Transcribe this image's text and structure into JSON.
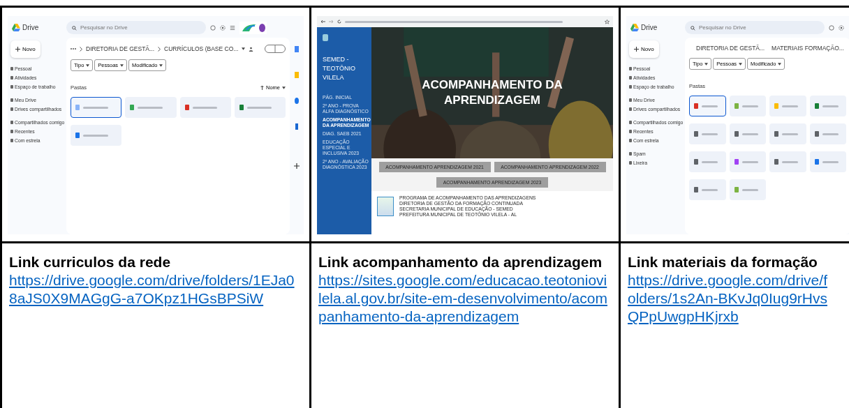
{
  "cells": [
    {
      "kind": "drive",
      "title": "Link curriculos da rede",
      "link": "https://drive.google.com/drive/folders/1EJa08aJS0X9MAGgG-a7OKpz1HGsBPSiW",
      "screen": {
        "app": "Drive",
        "search": {
          "placeholder": "Pesquisar no Drive"
        },
        "new_button": "Novo",
        "nav": [
          "Pessoal",
          "Atividades",
          "Espaço de trabalho",
          "Meu Drive",
          "Drives compartilhados",
          "Compartilhados comigo",
          "Recentes",
          "Com estrela"
        ],
        "breadcrumb": [
          "DIRETORIA DE GESTÃ...",
          "CURRÍCULOS (BASE CO..."
        ],
        "filters": [
          "Tipo",
          "Pessoas",
          "Modificado"
        ],
        "section": "Pastas",
        "sort": "Nome",
        "folders": [
          {
            "color": "#8ab4f8",
            "selected": true
          },
          {
            "color": "#34a853",
            "selected": false
          },
          {
            "color": "#d93025",
            "selected": false
          },
          {
            "color": "#188038",
            "selected": false
          },
          {
            "color": "#1a73e8",
            "selected": false
          }
        ],
        "rail": true
      }
    },
    {
      "kind": "site",
      "title": "Link acompanhamento da aprendizagem",
      "link": "https://sites.google.com/educacao.teotoniovilela.al.gov.br/site-em-desenvolvimento/acompanhamento-da-aprendizagem",
      "screen": {
        "site_name": "SEMED - TEOTÔNIO VILELA",
        "nav": [
          {
            "label": "PÁG. INICIAL",
            "selected": false
          },
          {
            "label": "2º ANO - PROVA ALFA DIAGNÓSTICO",
            "selected": false
          },
          {
            "label": "ACOMPANHAMENTO DA APRENDIZAGEM",
            "selected": true
          },
          {
            "label": "DIAG. SAEB 2021",
            "selected": false
          },
          {
            "label": "EDUCAÇÃO ESPECIAL E INCLUSIVA 2023",
            "selected": false
          },
          {
            "label": "2º ANO - AVALIAÇÃO DIAGNÓSTICA 2023",
            "selected": false
          }
        ],
        "hero_title": "ACOMPANHAMENTO DA APRENDIZAGEM",
        "buttons": [
          "ACOMPANHAMENTO APRENDIZAGEM 2021",
          "ACOMPANHAMENTO APRENDIZAGEM 2022",
          "ACOMPANHAMENTO APRENDIZAGEM 2023"
        ],
        "footer": [
          "PROGRAMA DE ACOMPANHAMENTO DAS APRENDIZAGENS",
          "DIRETORIA DE GESTÃO DA FORMAÇÃO CONTINUADA",
          "SECRETARIA MUNICIPAL DE EDUCAÇÃO - SEMED",
          "PREFEITURA MUNICIPAL DE TEOTÔNIO VILELA - AL"
        ]
      }
    },
    {
      "kind": "drive",
      "title": "Link materiais da formação",
      "link": "https://drive.google.com/drive/folders/1s2An-BKvJq0Iug9rHvsQPpUwgpHKjrxb",
      "screen": {
        "app": "Drive",
        "search": {
          "placeholder": "Pesquisar no Drive"
        },
        "new_button": "Novo",
        "nav": [
          "Pessoal",
          "Atividades",
          "Espaço de trabalho",
          "Meu Drive",
          "Drives compartilhados",
          "Compartilhados comigo",
          "Recentes",
          "Com estrela",
          "Spam",
          "Lixeira"
        ],
        "breadcrumb": [
          "DIRETORIA DE GESTÃ...",
          "MATERIAIS FORMAÇÃO..."
        ],
        "filters": [
          "Tipo",
          "Pessoas",
          "Modificado"
        ],
        "section": "Pastas",
        "folders": [
          {
            "color": "#d93025",
            "selected": true
          },
          {
            "color": "#7cb342",
            "selected": false
          },
          {
            "color": "#fbbc04",
            "selected": false
          },
          {
            "color": "#188038",
            "selected": false
          },
          {
            "color": "#5f6368",
            "selected": false
          },
          {
            "color": "#5f6368",
            "selected": false
          },
          {
            "color": "#5f6368",
            "selected": false
          },
          {
            "color": "#5f6368",
            "selected": false
          },
          {
            "color": "#5f6368",
            "selected": false
          },
          {
            "color": "#a142f4",
            "selected": false
          },
          {
            "color": "#5f6368",
            "selected": false
          },
          {
            "color": "#1a73e8",
            "selected": false
          },
          {
            "color": "#5f6368",
            "selected": false
          },
          {
            "color": "#7cb342",
            "selected": false
          }
        ],
        "rail": false
      }
    }
  ]
}
